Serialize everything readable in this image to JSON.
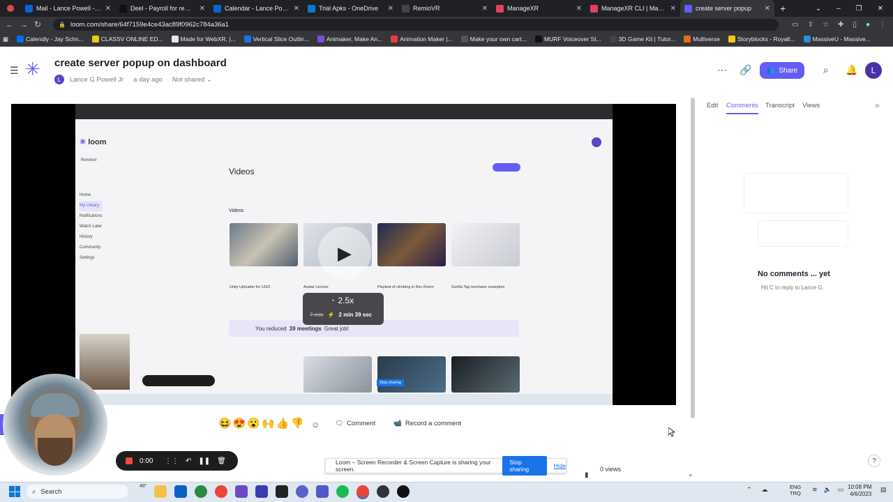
{
  "browser": {
    "tabs": [
      {
        "label": "Mail - Lance Powell - Out",
        "color": "#0a64d6"
      },
      {
        "label": "Deel - Payroll for remote",
        "color": "#111111"
      },
      {
        "label": "Calendar - Lance Powell",
        "color": "#0a64d6"
      },
      {
        "label": "Trial Apks - OneDrive",
        "color": "#0b78d4"
      },
      {
        "label": "RemioVR",
        "color": "#444444"
      },
      {
        "label": "ManageXR",
        "color": "#e6405e"
      },
      {
        "label": "ManageXR CLI | Manage",
        "color": "#e6405e"
      },
      {
        "label": "create server popup",
        "color": "#625df5",
        "active": true
      }
    ],
    "url": "loom.com/share/64f7159e4ce43ac89f0962c784a36a1",
    "bookmarks": [
      {
        "label": "Calendly - Jay Schn...",
        "color": "#006bff"
      },
      {
        "label": "CLASSV ONLINE ED...",
        "color": "#f0c419"
      },
      {
        "label": "Made for WebXR, |...",
        "color": "#e6e6e6"
      },
      {
        "label": "Vertical Slice Outlin...",
        "color": "#1a73e8"
      },
      {
        "label": "Animaker, Make An...",
        "color": "#7b4dd8"
      },
      {
        "label": "Animation Maker |...",
        "color": "#e04040"
      },
      {
        "label": "Make your own cart...",
        "color": "#555555"
      },
      {
        "label": "MURF Voiceover St...",
        "color": "#111111"
      },
      {
        "label": "3D Game Kit | Tutor...",
        "color": "#444444"
      },
      {
        "label": "Multiverse",
        "color": "#e86a1c"
      },
      {
        "label": "Storyblocks - Royalt...",
        "color": "#f5c518"
      },
      {
        "label": "MassiveU - Massive...",
        "color": "#2a8dd8"
      }
    ]
  },
  "header": {
    "title": "create server popup on dashboard",
    "author": "Lance G Powell Jr",
    "author_initial": "L",
    "time": "a day ago",
    "share_status": "Not shared",
    "share_label": "Share",
    "user_initial": "L"
  },
  "video": {
    "speed": "2.5x",
    "orig_time": "7 min",
    "saved_time": "2 min 39 sec",
    "loom_logo": "loom",
    "section_title": "Videos",
    "subsection": "Videos",
    "saved_banner_prefix": "You reduced",
    "saved_banner_count": "39 meetings",
    "saved_banner_suffix": "Great job!",
    "sidebar_items": [
      "Home",
      "My Library",
      "Notifications",
      "Watch Later",
      "History",
      "Community",
      "Settings"
    ],
    "card_titles": [
      "Unity Uploader for UGO",
      "Avatar Lecture",
      "Playtest of climbing in Rec Room",
      "Gorilla Tag mechanic examples"
    ],
    "workspace": "Remioor",
    "stop_sharing_mini": "Stop sharing"
  },
  "right_panel": {
    "tabs": [
      "Edit",
      "Comments",
      "Transcript",
      "Views"
    ],
    "active_tab": "Comments",
    "empty_title": "No comments ... yet",
    "empty_hint": "Hit C to reply to Lance G."
  },
  "reactions": [
    "😆",
    "😍",
    "😮",
    "🙌",
    "👍",
    "👎"
  ],
  "actions": {
    "comment": "Comment",
    "record_comment": "Record a comment"
  },
  "recorder": {
    "time": "0:00"
  },
  "sharing_bar": {
    "message": "Loom – Screen Recorder & Screen Capture is sharing your screen.",
    "stop": "Stop sharing",
    "hide": "Hide"
  },
  "stats": {
    "views": "0 views"
  },
  "taskbar": {
    "search_placeholder": "Search",
    "weather": "48°",
    "lang_line1": "ENG",
    "lang_line2": "TRQ",
    "time": "10:08 PM",
    "date": "4/6/2023"
  }
}
